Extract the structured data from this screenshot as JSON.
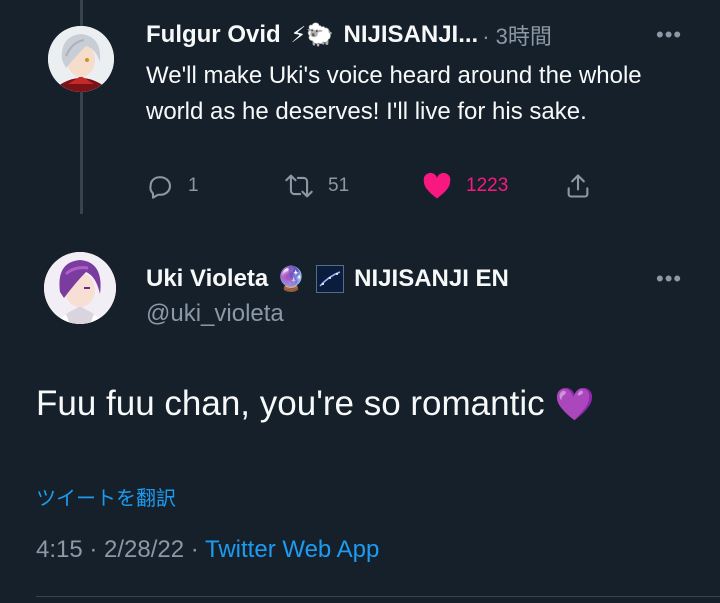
{
  "parent_tweet": {
    "author_name": "Fulgur Ovid",
    "author_emojis": "⚡🐑",
    "affiliation": "NIJISANJI...",
    "time": "· 3時間",
    "text": "We'll make Uki's voice heard around the whole world as he deserves! I'll live for his sake.",
    "replies": "1",
    "retweets": "51",
    "likes": "1223",
    "liked": true
  },
  "main_tweet": {
    "author_name": "Uki Violeta",
    "author_emojis": "🔮",
    "affiliation": "NIJISANJI EN",
    "handle": "@uki_violeta",
    "text": "Fuu fuu chan, you're so romantic",
    "text_emoji": "💜",
    "translate_label": "ツイートを翻訳",
    "timestamp": "4:15 · 2/28/22 · ",
    "source_app": "Twitter Web App"
  },
  "more_label": "•••",
  "colors": {
    "background": "#15202b",
    "text": "#f7f9f9",
    "muted": "#8b98a5",
    "link": "#1d9bf0",
    "like": "#f91880"
  }
}
